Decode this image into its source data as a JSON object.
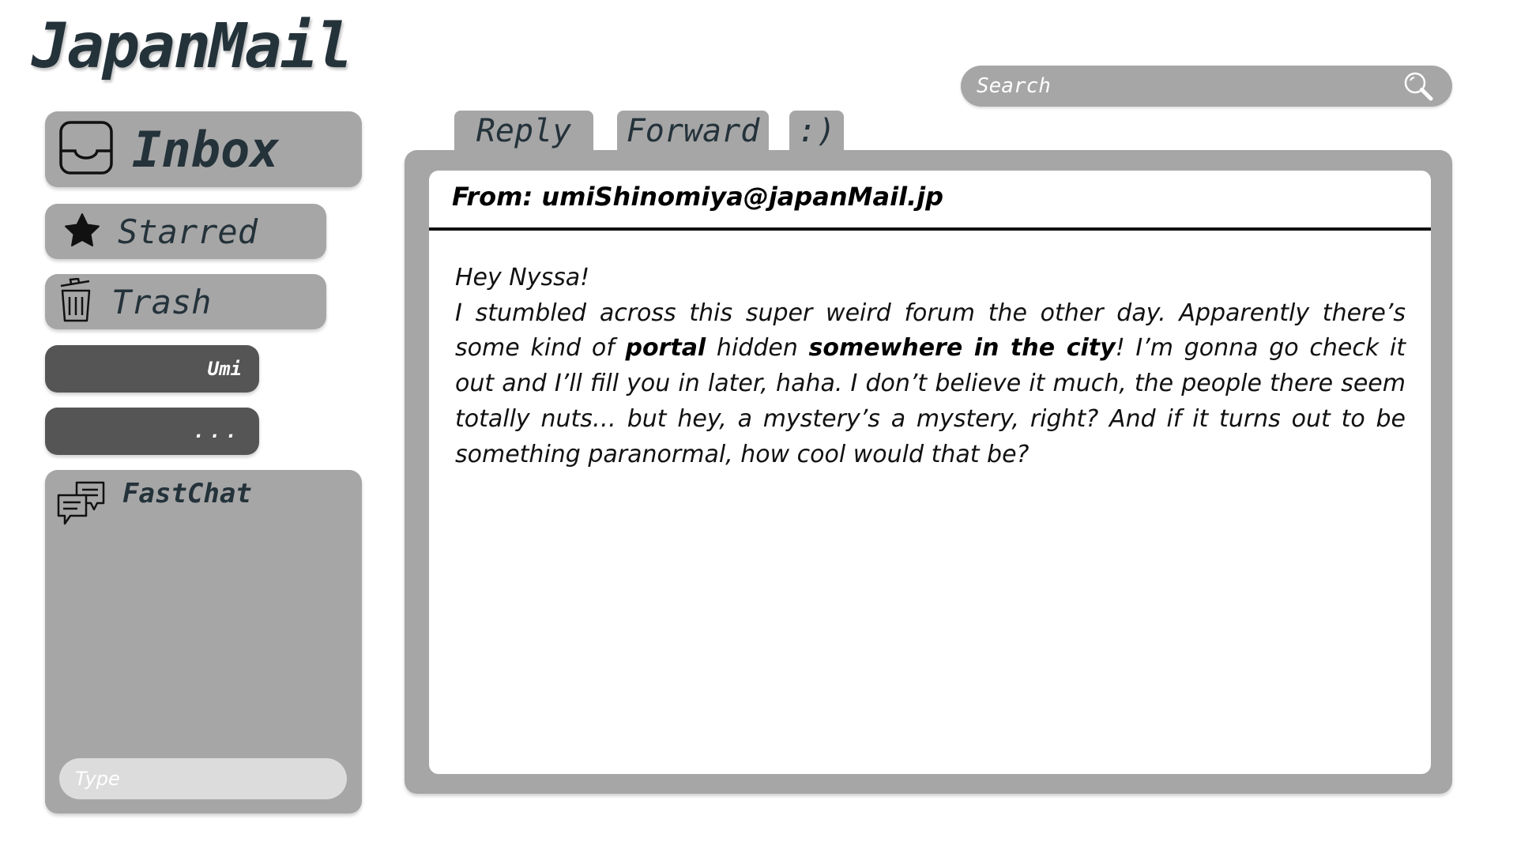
{
  "app": {
    "title": "JapanMail"
  },
  "sidebar": {
    "inbox_label": "Inbox",
    "starred_label": "Starred",
    "trash_label": "Trash",
    "contacts": [
      {
        "label": "Umi"
      },
      {
        "label": "..."
      }
    ]
  },
  "fastchat": {
    "title": "FastChat",
    "input_placeholder": "Type"
  },
  "search": {
    "placeholder": "Search"
  },
  "tabs": {
    "reply": "Reply",
    "forward": "Forward",
    "smile": ":)"
  },
  "message": {
    "from": "From: umiShinomiya@japanMail.jp",
    "greeting": "Hey Nyssa!",
    "body_part1": "I stumbled across this super weird forum the other day. Apparently there’s some kind of ",
    "body_bold1": "portal",
    "body_part2": " hidden ",
    "body_bold2": "somewhere in the city",
    "body_part3": "! I’m gonna go check it out and I’ll fill you in later, haha. I don’t believe it much, the people there seem totally nuts… but hey, a mystery’s a mystery, right? And if it turns out to be something paranormal, how cool would that be?"
  },
  "colors": {
    "panel_gray": "#a6a6a6",
    "contact_dark": "#555555",
    "text_dark": "#24323a"
  }
}
